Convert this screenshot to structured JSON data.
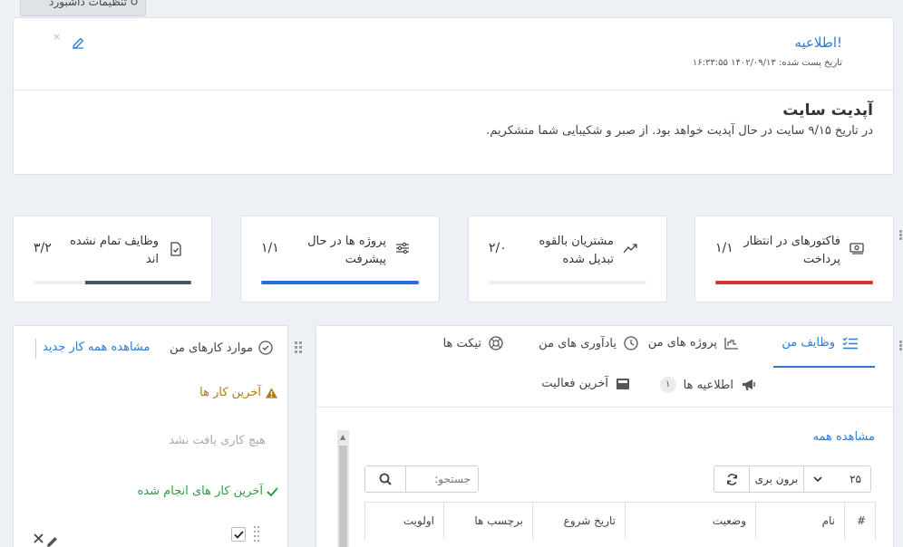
{
  "dashboard_settings_tab": {
    "label": "تنظیمات داشبورد"
  },
  "announcement": {
    "title": "اطلاعیه!",
    "posted_date": "تاریخ پست شده: ۱۴۰۲/۰۹/۱۳ ۱۶:۳۳:۵۵",
    "close_glyph": "×",
    "body_title": "آپدیت سایت",
    "body_text": "در تاریخ ۹/۱۵ سایت در حال آپدیت خواهد بود. از صبر و شکیبایی شما متشکریم."
  },
  "stats": [
    {
      "id": "invoices",
      "label": "فاکتورهای در انتظار پرداخت",
      "value": "۱/۱",
      "progress": 1.0,
      "color": "#d9302c",
      "icon": "money-icon"
    },
    {
      "id": "customers",
      "label": "مشتریان بالقوه تبدیل شده",
      "value": "۲/۰",
      "progress": 0.0,
      "color": "#2e9d47",
      "icon": "trend-icon"
    },
    {
      "id": "projects",
      "label": "پروژه ها در حال پیشرفت",
      "value": "۱/۱",
      "progress": 1.0,
      "color": "#2b6fd6",
      "icon": "sliders-icon"
    },
    {
      "id": "tasks",
      "label": "وظایف تمام نشده اند",
      "value": "۳/۲",
      "progress": 0.67,
      "color": "#4a5560",
      "icon": "file-check-icon"
    }
  ],
  "tabs": {
    "my_tasks": "وظایف من",
    "my_projects": "پروژه های من",
    "my_reminders": "یادآوری های من",
    "tickets": "تیکت ها",
    "announcements": "اطلاعیه ها",
    "announcements_count": "۱",
    "latest_activity": "آخرین فعالیت"
  },
  "table": {
    "view_all": "مشاهده همه",
    "page_size": "۲۵",
    "page_size_options_label": "برون بری",
    "search_placeholder": "جستجو:",
    "columns": [
      "#",
      "نام",
      "وضعیت",
      "تاریخ شروع",
      "برچسب ها",
      "اولویت"
    ]
  },
  "my_tasks_panel": {
    "title": "موارد کارهای من",
    "view_all": "مشاهده همه کار جدید",
    "latest_title": "آخرین کار ها",
    "empty": "هیچ کاری یافت نشد",
    "done_title": "آخرین کار های انجام شده"
  },
  "colors": {
    "accent": "#2b7bd2",
    "warning": "#b5771a",
    "success": "#2e9d47"
  }
}
